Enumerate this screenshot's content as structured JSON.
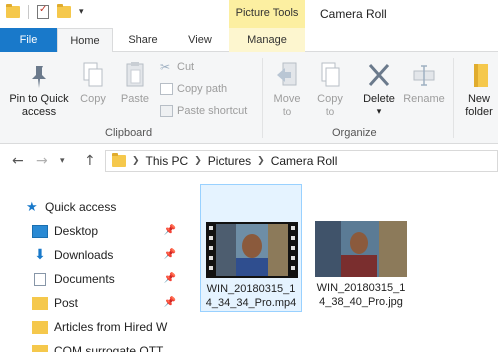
{
  "titlebar": {
    "context_group": "Picture Tools",
    "window_title": "Camera Roll"
  },
  "tabs": {
    "file": "File",
    "home": "Home",
    "share": "Share",
    "view": "View",
    "manage": "Manage"
  },
  "ribbon": {
    "clipboard": {
      "pin_to_quick_access": [
        "Pin to Quick",
        "access"
      ],
      "copy": "Copy",
      "paste": "Paste",
      "cut": "Cut",
      "copy_path": "Copy path",
      "paste_shortcut": "Paste shortcut",
      "group_label": "Clipboard"
    },
    "organize": {
      "move_to": [
        "Move",
        "to"
      ],
      "copy_to": [
        "Copy",
        "to"
      ],
      "delete": "Delete",
      "rename": "Rename",
      "group_label": "Organize"
    },
    "new": {
      "new_folder": [
        "New",
        "folder"
      ]
    }
  },
  "address": {
    "crumbs": [
      "This PC",
      "Pictures",
      "Camera Roll"
    ]
  },
  "nav": {
    "items": [
      {
        "label": "Quick access"
      },
      {
        "label": "Desktop"
      },
      {
        "label": "Downloads"
      },
      {
        "label": "Documents"
      },
      {
        "label": "Post"
      },
      {
        "label": "Articles from Hired W"
      },
      {
        "label": "COM surrogate OTT"
      }
    ]
  },
  "files": [
    {
      "name_line1": "WIN_20180315_1",
      "name_line2": "4_34_34_Pro.mp4"
    },
    {
      "name_line1": "WIN_20180315_1",
      "name_line2": "4_38_40_Pro.jpg"
    }
  ],
  "colors": {
    "accent": "#1979ca",
    "context_tab": "#fcefa1",
    "selection": "#e5f3ff"
  }
}
